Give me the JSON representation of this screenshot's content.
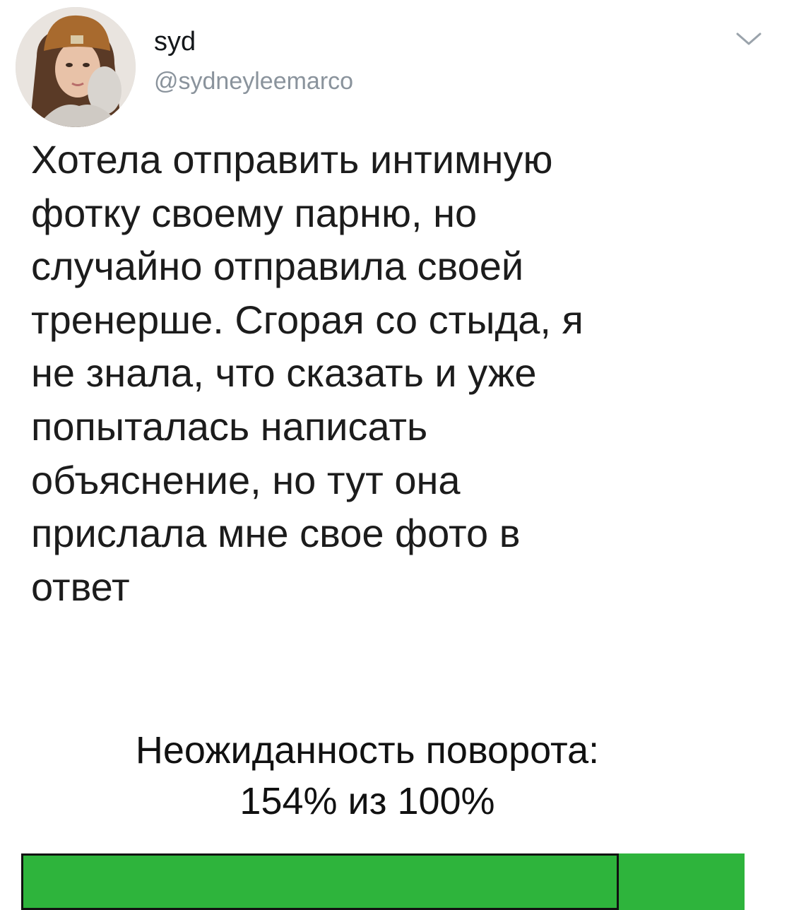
{
  "tweet": {
    "display_name": "syd",
    "handle": "@sydneyleemarco",
    "avatar_icon": "user-avatar",
    "menu_icon": "chevron-down-icon",
    "text": "Хотела отправить интимную\nфотку своему парню, но\nслучайно отправила своей\nтренерше. Сгорая со стыда, я\nне знала, что сказать и уже\nпопыталась написать\nобъяснение, но тут она\nприслала мне свое фото в\nответ"
  },
  "caption": {
    "line1": "Неожиданность поворота:",
    "line2": "154% из 100%"
  },
  "meter": {
    "value_percent": 154,
    "max_percent": 100,
    "fill_color": "#2eb43c"
  }
}
